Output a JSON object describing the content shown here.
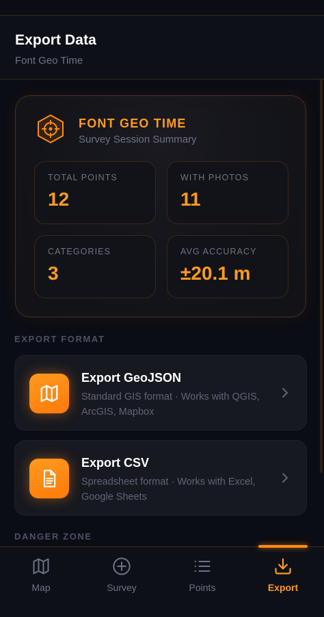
{
  "header": {
    "title": "Export Data",
    "subtitle": "Font Geo Time"
  },
  "summary": {
    "icon": "target-hexagon-icon",
    "title": "FONT GEO TIME",
    "subtitle": "Survey Session Summary",
    "stats": [
      {
        "label": "TOTAL POINTS",
        "value": "12"
      },
      {
        "label": "WITH PHOTOS",
        "value": "11"
      },
      {
        "label": "CATEGORIES",
        "value": "3"
      },
      {
        "label": "AVG ACCURACY",
        "value": "±20.1 m"
      }
    ]
  },
  "sections": {
    "export_format": "EXPORT FORMAT",
    "danger_zone": "DANGER ZONE"
  },
  "exports": [
    {
      "icon": "map-icon",
      "title": "Export GeoJSON",
      "description": "Standard GIS format · Works with QGIS, ArcGIS, Mapbox"
    },
    {
      "icon": "document-icon",
      "title": "Export CSV",
      "description": "Spreadsheet format · Works with Excel, Google Sheets"
    }
  ],
  "nav": {
    "items": [
      {
        "label": "Map",
        "icon": "map-icon"
      },
      {
        "label": "Survey",
        "icon": "plus-circle-icon"
      },
      {
        "label": "Points",
        "icon": "list-icon"
      },
      {
        "label": "Export",
        "icon": "download-icon"
      }
    ],
    "active": "Export"
  },
  "colors": {
    "background": "#0b0d14",
    "accent": "#ff9a1f",
    "card": "#171920",
    "muted_text": "#6b7485"
  }
}
